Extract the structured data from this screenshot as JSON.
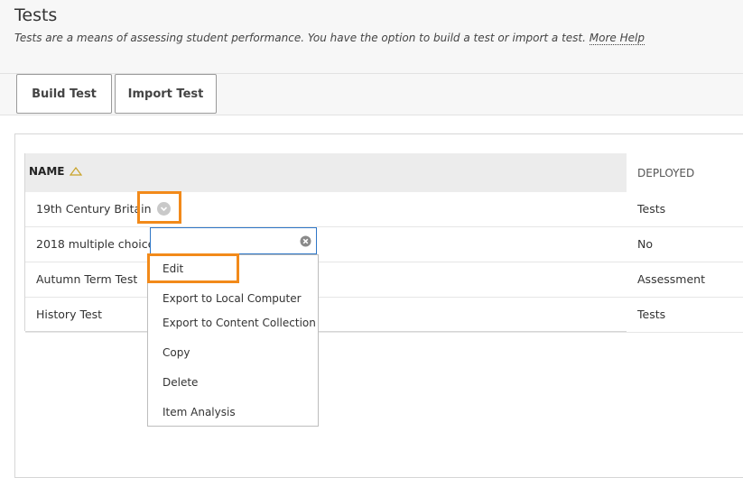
{
  "header": {
    "title": "Tests",
    "description": "Tests are a means of assessing student performance. You have the option to build a test or import a test.",
    "more_help": "More Help"
  },
  "actions": {
    "build_test": "Build Test",
    "import_test": "Import Test"
  },
  "table": {
    "columns": {
      "name": "NAME",
      "deployed": "DEPLOYED"
    },
    "sort_icon": "sort-ascending-triangle-icon",
    "rows": [
      {
        "name": "19th Century Britain",
        "deployed": "Tests"
      },
      {
        "name": "2018 multiple choice",
        "deployed": "No"
      },
      {
        "name": "Autumn Term Test",
        "deployed": "Assessment"
      },
      {
        "name": "History Test",
        "deployed": "Tests"
      }
    ]
  },
  "context_menu": {
    "search_value": "",
    "clear_icon": "clear-icon",
    "items": [
      "Edit",
      "Export to Local Computer",
      "Export to Content Collection",
      "Copy",
      "Delete",
      "Item Analysis"
    ]
  },
  "colors": {
    "highlight": "#f28a1a",
    "input_border": "#2f77c7",
    "header_bg": "#f7f7f7"
  }
}
